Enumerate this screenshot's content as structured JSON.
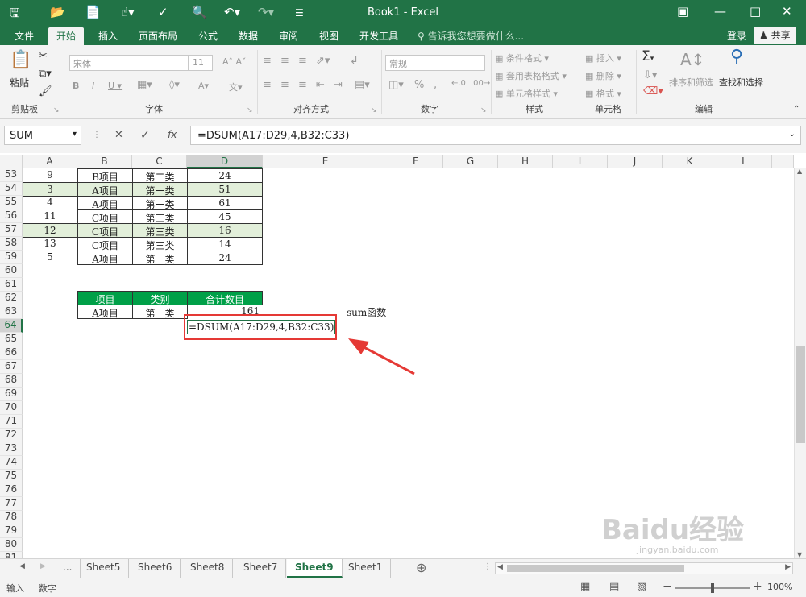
{
  "window": {
    "title": "Book1 - Excel",
    "login": "登录",
    "share": "共享"
  },
  "tabs": [
    "文件",
    "开始",
    "插入",
    "页面布局",
    "公式",
    "数据",
    "审阅",
    "视图",
    "开发工具"
  ],
  "tell_me": "告诉我您想要做什么...",
  "ribbon": {
    "paste": "粘贴",
    "font_name": "宋体",
    "font_size": "11",
    "number_format": "常规",
    "cond_format": "条件格式",
    "table_format": "套用表格格式",
    "cell_style": "单元格样式",
    "insert": "插入",
    "delete": "删除",
    "format": "格式",
    "sort_filter": "排序和筛选",
    "find_select": "查找和选择",
    "groups": [
      "剪贴板",
      "字体",
      "对齐方式",
      "数字",
      "样式",
      "单元格",
      "编辑"
    ]
  },
  "formula_bar": {
    "name_box": "SUM",
    "formula": "=DSUM(A17:D29,4,B32:C33)",
    "cancel": "✕",
    "enter": "✓",
    "fx": "fx"
  },
  "columns": [
    "A",
    "B",
    "C",
    "D",
    "E",
    "F",
    "G",
    "H",
    "I",
    "J",
    "K",
    "L"
  ],
  "row_numbers": [
    "53",
    "54",
    "55",
    "56",
    "57",
    "58",
    "59",
    "60",
    "61",
    "62",
    "63",
    "64",
    "65",
    "66",
    "67",
    "68",
    "69",
    "70",
    "71",
    "72",
    "73",
    "74",
    "75",
    "76",
    "77",
    "78",
    "79",
    "80",
    "81"
  ],
  "data_rows": [
    {
      "a": "9",
      "b": "B项目",
      "c": "第二类",
      "d": "24"
    },
    {
      "a": "3",
      "b": "A项目",
      "c": "第一类",
      "d": "51"
    },
    {
      "a": "4",
      "b": "A项目",
      "c": "第一类",
      "d": "61"
    },
    {
      "a": "11",
      "b": "C项目",
      "c": "第三类",
      "d": "45"
    },
    {
      "a": "12",
      "b": "C项目",
      "c": "第三类",
      "d": "16"
    },
    {
      "a": "13",
      "b": "C项目",
      "c": "第三类",
      "d": "14"
    },
    {
      "a": "5",
      "b": "A项目",
      "c": "第一类",
      "d": "24"
    }
  ],
  "criteria": {
    "h1": "项目",
    "h2": "类别",
    "h3": "合计数目",
    "v1": "A项目",
    "v2": "第一类",
    "v3": "161"
  },
  "edit_cell": "=DSUM(A17:D29,4,B32:C33)",
  "note": "sum函数",
  "sheets": [
    "...",
    "Sheet5",
    "Sheet6",
    "Sheet8",
    "Sheet7",
    "Sheet9",
    "Sheet1"
  ],
  "status": {
    "mode": "输入",
    "digit": "数字",
    "zoom": "100%"
  },
  "watermark": "Baidu经验",
  "watermark_url": "jingyan.baidu.com",
  "colors": {
    "excel_green": "#217346",
    "criteria_header": "#00a048",
    "highlight_row": "#e2efda",
    "annotation_red": "#e53935"
  }
}
